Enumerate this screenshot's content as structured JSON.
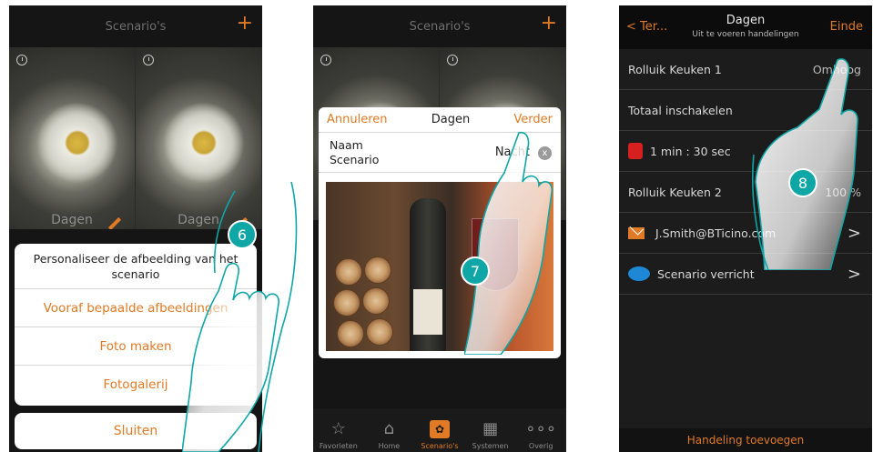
{
  "colors": {
    "accent": "#e07a24",
    "badge": "#0fa6a6",
    "hand_outline": "#0fa6a6"
  },
  "screen1": {
    "title": "Scenario's",
    "plus": "+",
    "tiles": [
      {
        "label": "Dagen"
      },
      {
        "label": "Dagen"
      }
    ],
    "sheet_title": "Personaliseer de afbeelding van het scenario",
    "options": [
      "Vooraf bepaalde afbeeldingen",
      "Foto maken",
      "Fotogalerij"
    ],
    "close": "Sluiten",
    "step": "6"
  },
  "screen2": {
    "title": "Scenario's",
    "plus": "+",
    "cancel": "Annuleren",
    "dialog_title": "Dagen",
    "next": "Verder",
    "name_label": "Naam Scenario",
    "name_value": "Nacht",
    "clear_icon": "x",
    "step": "7",
    "tabs": [
      {
        "label": "Favorieten",
        "icon": "star-icon",
        "glyph": "☆"
      },
      {
        "label": "Home",
        "icon": "home-icon",
        "glyph": "⌂"
      },
      {
        "label": "Scenario's",
        "icon": "scenario-icon",
        "glyph": "✿"
      },
      {
        "label": "Systemen",
        "icon": "grid-icon",
        "glyph": "▦"
      },
      {
        "label": "Overig",
        "icon": "more-icon",
        "glyph": "∘∘∘"
      }
    ]
  },
  "screen3": {
    "back": "< Ter...",
    "title": "Dagen",
    "subtitle": "Uit te voeren handelingen",
    "done": "Einde",
    "rows": [
      {
        "label": "Rolluik Keuken 1",
        "value": "Omhoog"
      },
      {
        "label": "Totaal inschakelen",
        "value": ""
      },
      {
        "label": "1 min : 30 sec",
        "value": ""
      },
      {
        "label": "Rolluik Keuken 2",
        "value": "100 %"
      },
      {
        "label": "J.Smith@BTicino.com",
        "value": ">"
      },
      {
        "label": "Scenario verricht",
        "value": ">"
      }
    ],
    "footer": "Handeling toevoegen",
    "step": "8"
  }
}
